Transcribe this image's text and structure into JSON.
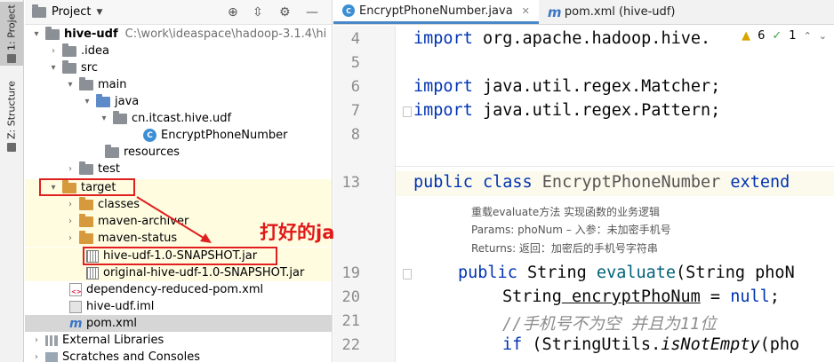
{
  "sidebar_tabs": {
    "project": "1: Project",
    "structure": "Z: Structure"
  },
  "panel": {
    "title": "Project"
  },
  "tree": [
    {
      "label": "hive-udf",
      "path": "C:\\work\\ideaspace\\hadoop-3.1.4\\hi"
    },
    {
      "label": ".idea"
    },
    {
      "label": "src"
    },
    {
      "label": "main"
    },
    {
      "label": "java"
    },
    {
      "label": "cn.itcast.hive.udf"
    },
    {
      "label": "EncryptPhoneNumber"
    },
    {
      "label": "resources"
    },
    {
      "label": "test"
    },
    {
      "label": "target"
    },
    {
      "label": "classes"
    },
    {
      "label": "maven-archiver"
    },
    {
      "label": "maven-status"
    },
    {
      "label": "hive-udf-1.0-SNAPSHOT.jar"
    },
    {
      "label": "original-hive-udf-1.0-SNAPSHOT.jar"
    },
    {
      "label": "dependency-reduced-pom.xml"
    },
    {
      "label": "hive-udf.iml"
    },
    {
      "label": "pom.xml"
    },
    {
      "label": "External Libraries"
    },
    {
      "label": "Scratches and Consoles"
    }
  ],
  "annotation": "打好的jar包",
  "editor": {
    "tabs": [
      {
        "label": "EncryptPhoneNumber.java",
        "icon": "C"
      },
      {
        "label": "pom.xml (hive-udf)",
        "icon": "m"
      }
    ],
    "inspections": {
      "warnings": "6",
      "ok": "1"
    },
    "line_numbers": [
      "4",
      "5",
      "6",
      "7",
      "8",
      "13",
      "19",
      "20",
      "21",
      "22"
    ],
    "code": {
      "l4_kw": "import",
      "l4_rest": " org.apache.hadoop.hive.",
      "l6_kw": "import",
      "l6_rest": " java.util.regex.Matcher;",
      "l7_kw": "import",
      "l7_rest": " java.util.regex.Pattern;",
      "l13_kw1": "public",
      "l13_kw2": " class",
      "l13_name": " EncryptPhoneNumber",
      "l13_ext": " extend",
      "l19_kw": "public",
      "l19_type": " String",
      "l19_fn": " evaluate",
      "l19_rest": "(String phoN",
      "l20_type": "String",
      "l20_var": " encryptPhoNum",
      "l20_eq": " = ",
      "l20_null": "null",
      "l20_end": ";",
      "l21_cm": "//手机号不为空 并且为11位",
      "l22_kw": "if",
      "l22_rest": " (StringUtils.",
      "l22_fn": "isNotEmpty",
      "l22_end": "(pho"
    },
    "doc": {
      "line1": "重载evaluate方法 实现函数的业务逻辑",
      "line2": "Params: phoNum – 入参：未加密手机号",
      "line3": "Returns: 返回：加密后的手机号字符串"
    }
  }
}
